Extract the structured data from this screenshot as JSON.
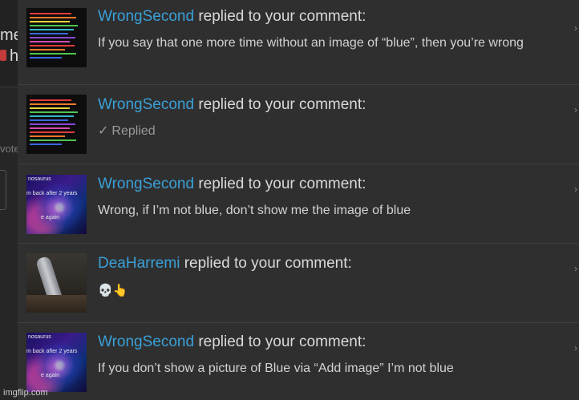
{
  "notifications": [
    {
      "username": "WrongSecond",
      "action": " replied to your comment:",
      "message": "If you say that one more time without an image of “blue”, then you’re wrong",
      "thumb": "rainbow-text"
    },
    {
      "username": "WrongSecond",
      "action": " replied to your comment:",
      "message": "Replied",
      "status_icon": "check-icon",
      "thumb": "rainbow-text"
    },
    {
      "username": "WrongSecond",
      "action": " replied to your comment:",
      "message": "Wrong, if I’m not blue, don’t show me the image of blue",
      "thumb": "galaxy"
    },
    {
      "username": "DeaHarremi",
      "action": " replied to your comment:",
      "message": "💀👆",
      "thumb": "photo"
    },
    {
      "username": "WrongSecond",
      "action": " replied to your comment:",
      "message": "If you don’t show a picture of Blue via “Add image” I’m not blue",
      "thumb": "galaxy"
    }
  ],
  "galaxy_caption": {
    "line1": "nosaurus",
    "line2": "m back after 2 years",
    "line3": "e again"
  },
  "gutter": {
    "text1": "me",
    "text2": "h",
    "vote": "vote"
  },
  "watermark": "imgflip.com",
  "colors": {
    "username": "#3aa0d8",
    "background": "#2f2f2f"
  }
}
